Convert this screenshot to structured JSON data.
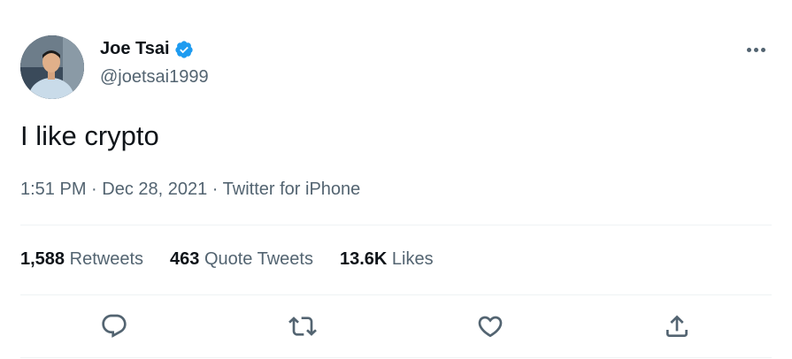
{
  "tweet": {
    "author": {
      "display_name": "Joe Tsai",
      "handle": "@joetsai1999",
      "verified": true
    },
    "text": "I like crypto",
    "timestamp": {
      "time": "1:51 PM",
      "separator": " · ",
      "date": "Dec 28, 2021",
      "source": "Twitter for iPhone"
    },
    "stats": {
      "retweets_count": "1,588",
      "retweets_label": "Retweets",
      "quotes_count": "463",
      "quotes_label": "Quote Tweets",
      "likes_count": "13.6K",
      "likes_label": "Likes"
    },
    "actions": [
      "reply-icon",
      "retweet-icon",
      "like-icon",
      "share-icon"
    ]
  },
  "colors": {
    "text_primary": "#0f1419",
    "text_secondary": "#536471",
    "verified_badge": "#1d9bf0",
    "divider": "#eff3f4"
  }
}
